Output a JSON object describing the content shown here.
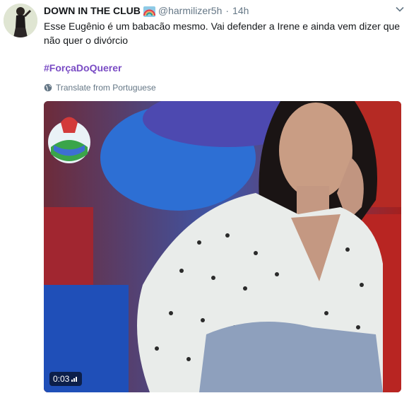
{
  "tweet": {
    "display_name": "DOWN IN THE CLUB",
    "name_emoji": "rainbow-icon",
    "handle": "@harmilizer5h",
    "separator": "·",
    "time": "14h",
    "text": "Esse Eugênio é um babacão mesmo. Vai defender a Irene e ainda vem dizer que não quer o divórcio",
    "hashtag": "#ForçaDoQuerer",
    "translate_label": "Translate from Portuguese"
  },
  "media": {
    "type": "video",
    "duration": "0:03",
    "volume_icon": "volume-bars-icon"
  },
  "colors": {
    "text": "#14171a",
    "secondary": "#657786",
    "hashtag": "#794bc4"
  }
}
